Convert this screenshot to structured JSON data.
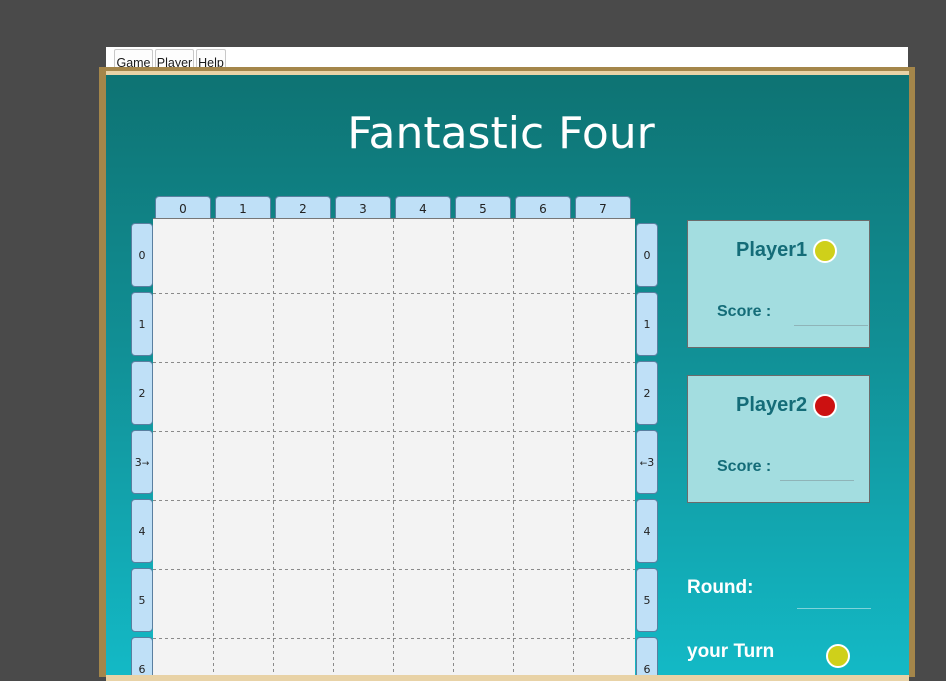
{
  "menu": {
    "game": "Game",
    "player": "Player",
    "help": "Help"
  },
  "game": {
    "title": "Fantastic Four"
  },
  "board": {
    "columns": [
      "0",
      "1",
      "2",
      "3",
      "4",
      "5",
      "6",
      "7"
    ],
    "rows": [
      "0",
      "1",
      "2",
      "3",
      "4",
      "5",
      "6"
    ],
    "row_marker_left": "→",
    "row_marker_right": "←"
  },
  "players": [
    {
      "name": "Player1",
      "score_label": "Score :",
      "score": "",
      "token_color": "#cfd01a"
    },
    {
      "name": "Player2",
      "score_label": "Score :",
      "score": "",
      "token_color": "#cc1111"
    }
  ],
  "status": {
    "round_label": "Round:",
    "round_value": "",
    "turn_label": "your Turn",
    "turn_token_color": "#cfd01a"
  }
}
